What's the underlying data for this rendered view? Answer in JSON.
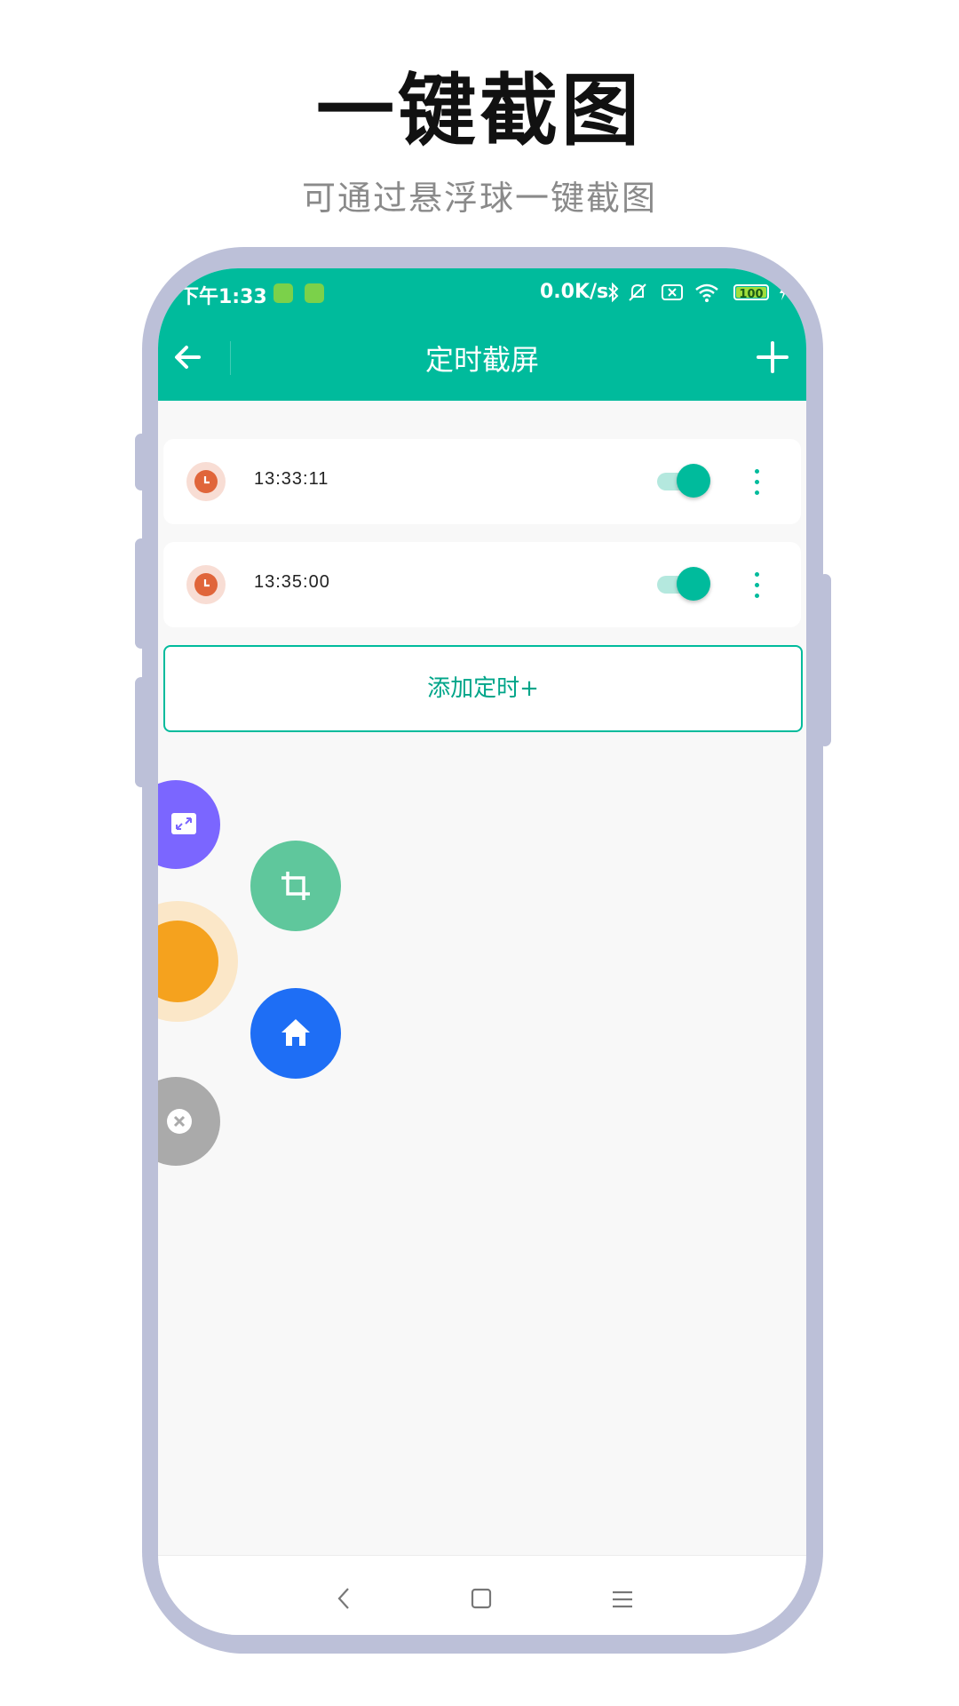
{
  "promo": {
    "headline": "一键截图",
    "subline": "可通过悬浮球一键截图"
  },
  "status_bar": {
    "time": "下午1:33",
    "net_speed": "0.0K/s",
    "battery": "100",
    "icons": [
      "app-notification-icon",
      "app-notification-icon",
      "bluetooth-icon",
      "mute-icon",
      "sim-icon",
      "wifi-icon",
      "battery-icon",
      "charging-icon"
    ]
  },
  "app_bar": {
    "title": "定时截屏",
    "back_icon": "arrow-left-icon",
    "add_icon": "plus-icon"
  },
  "timers": [
    {
      "time": "13:33:11",
      "enabled": true
    },
    {
      "time": "13:35:00",
      "enabled": true
    }
  ],
  "add_button_label": "添加定时+",
  "floating_menu": {
    "items": [
      "expand-icon",
      "crop-icon",
      "float-ball",
      "home-icon",
      "close-icon"
    ]
  },
  "colors": {
    "accent": "#00bb9c",
    "phone_frame": "#bcc0d8",
    "clock": "#e0653a",
    "expand_fab": "#7b66ff",
    "crop_fab": "#5fc79c",
    "ball_fab": "#f5a21e",
    "home_fab": "#1e6ef5",
    "close_fab": "#aaaaaa"
  }
}
